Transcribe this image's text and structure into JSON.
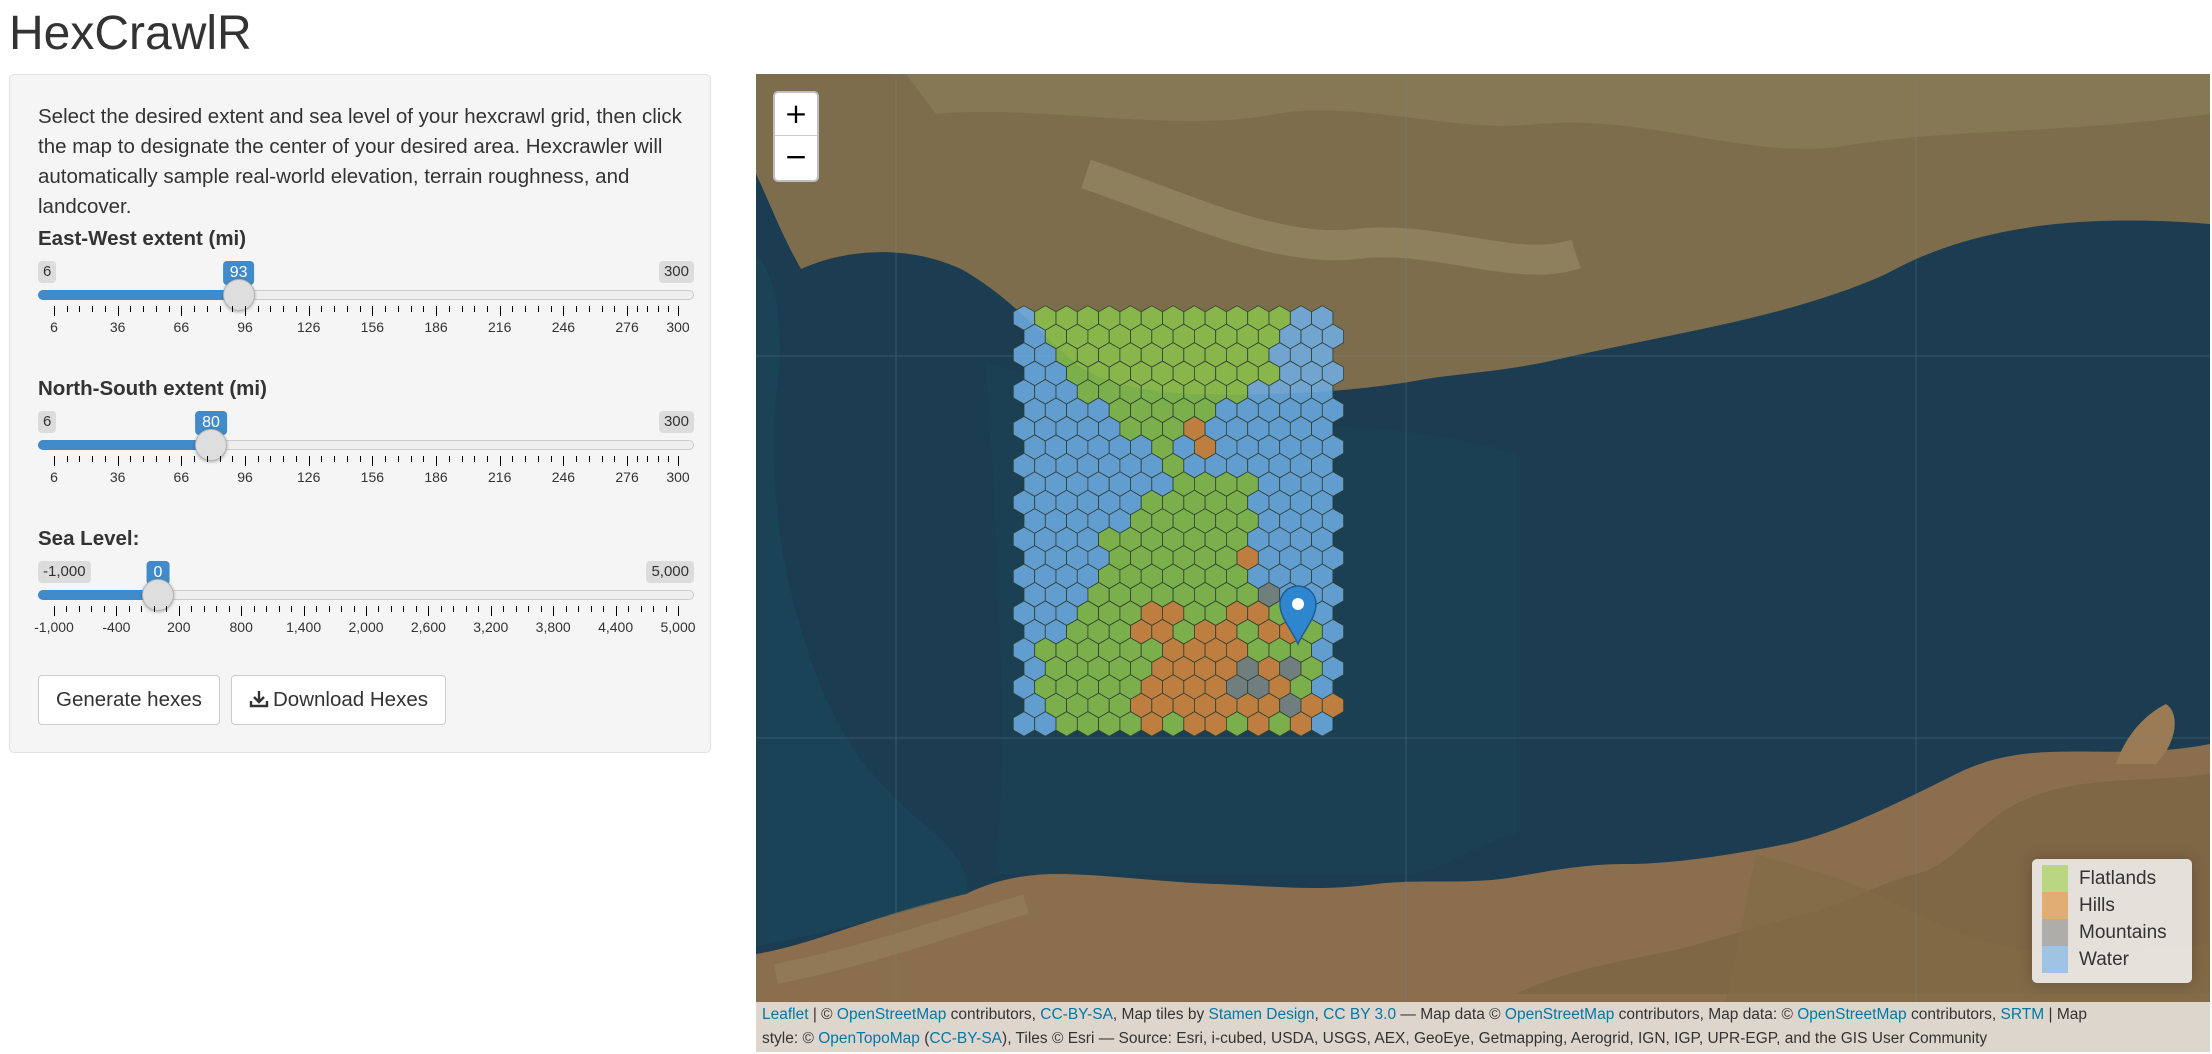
{
  "app": {
    "title": "HexCrawlR"
  },
  "sidebar": {
    "intro": "Select the desired extent and sea level of your hexcrawl grid, then click the map to designate the center of your desired area. Hexcrawler will automatically sample real-world elevation, terrain roughness, and landcover.",
    "sliders": {
      "ew": {
        "label": "East-West extent (mi)",
        "min_label": "6",
        "max_label": "300",
        "value_label": "93",
        "min": 6,
        "max": 300,
        "value": 93,
        "ticks": [
          "6",
          "36",
          "66",
          "96",
          "126",
          "156",
          "186",
          "216",
          "246",
          "276",
          "300"
        ],
        "tick_values": [
          6,
          36,
          66,
          96,
          126,
          156,
          186,
          216,
          246,
          276,
          300
        ]
      },
      "ns": {
        "label": "North-South extent (mi)",
        "min_label": "6",
        "max_label": "300",
        "value_label": "80",
        "min": 6,
        "max": 300,
        "value": 80,
        "ticks": [
          "6",
          "36",
          "66",
          "96",
          "126",
          "156",
          "186",
          "216",
          "246",
          "276",
          "300"
        ],
        "tick_values": [
          6,
          36,
          66,
          96,
          126,
          156,
          186,
          216,
          246,
          276,
          300
        ]
      },
      "sea": {
        "label": "Sea Level:",
        "min_label": "-1,000",
        "max_label": "5,000",
        "value_label": "0",
        "min": -1000,
        "max": 5000,
        "value": 0,
        "ticks": [
          "-1,000",
          "-400",
          "200",
          "800",
          "1,400",
          "2,000",
          "2,600",
          "3,200",
          "3,800",
          "4,400",
          "5,000"
        ],
        "tick_values": [
          -1000,
          -400,
          200,
          800,
          1400,
          2000,
          2600,
          3200,
          3800,
          4400,
          5000
        ]
      }
    },
    "buttons": {
      "generate": "Generate hexes",
      "download": "Download Hexes",
      "download_icon": "download-icon"
    }
  },
  "map": {
    "zoom_in": "+",
    "zoom_out": "−",
    "marker_icon": "map-marker-icon",
    "legend": [
      {
        "label": "Flatlands",
        "color": "#9ccf4a"
      },
      {
        "label": "Hills",
        "color": "#e08a2e"
      },
      {
        "label": "Mountains",
        "color": "#8a8a8a"
      },
      {
        "label": "Water",
        "color": "#6fb1ea"
      }
    ],
    "terrain_colors": {
      "F": "#8bc34a",
      "H": "#d98a3c",
      "M": "#7f8a86",
      "W": "#6eaee6"
    },
    "hex_rows": [
      "WFFFFFFFFFFFFWW",
      "WFFFFFFFFFFFWWW",
      "WWFFFFFFFFFFWWW",
      "WWFFFFFFFFFFWWW",
      "WWWFFFFFFFFWWWW",
      "WWWWFFFFFWWWWWW",
      "WWWWWFFFHWWWWWW",
      "WWWWWWFWHWWWWWW",
      "WWWWWWWFWWWWWWW",
      "WWWWWWWFFFFWWWW",
      "WWWWWWFFFFFWWWW",
      "WWWWWFFFFFFWWWW",
      "WWWWFFFFFFFWWWW",
      "WWWWFFFFFFHWWWW",
      "WWWWFFFFFFFWWWW",
      "WWWFFFFFFFFMWWW",
      "WWWFFFHHFFHHFWW",
      "WWFFFHHFHHFHHFW",
      "WFFFFFFHHHHFFFW",
      "WFFFFFHHHHMHMFW",
      "WFFFFFHHHHMMHFW",
      "WFFFFHHHHHHHMHH",
      "WWFFFFHFHHFHFHW"
    ],
    "attribution_line1": [
      {
        "text": "Leaflet",
        "link": true
      },
      {
        "text": " | © ",
        "link": false
      },
      {
        "text": "OpenStreetMap",
        "link": true
      },
      {
        "text": " contributors, ",
        "link": false
      },
      {
        "text": "CC-BY-SA",
        "link": true
      },
      {
        "text": ", Map tiles by ",
        "link": false
      },
      {
        "text": "Stamen Design",
        "link": true
      },
      {
        "text": ", ",
        "link": false
      },
      {
        "text": "CC BY 3.0",
        "link": true
      },
      {
        "text": " — Map data © ",
        "link": false
      },
      {
        "text": "OpenStreetMap",
        "link": true
      },
      {
        "text": " contributors, Map data: © ",
        "link": false
      },
      {
        "text": "OpenStreetMap",
        "link": true
      },
      {
        "text": " contributors, ",
        "link": false
      },
      {
        "text": "SRTM",
        "link": true
      },
      {
        "text": " | Map",
        "link": false
      }
    ],
    "attribution_line2": [
      {
        "text": "style: © ",
        "link": false
      },
      {
        "text": "OpenTopoMap",
        "link": true
      },
      {
        "text": " (",
        "link": false
      },
      {
        "text": "CC-BY-SA",
        "link": true
      },
      {
        "text": "), Tiles © Esri — Source: Esri, i-cubed, USDA, USGS, AEX, GeoEye, Getmapping, Aerogrid, IGN, IGP, UPR-EGP, and the GIS User Community",
        "link": false
      }
    ]
  }
}
